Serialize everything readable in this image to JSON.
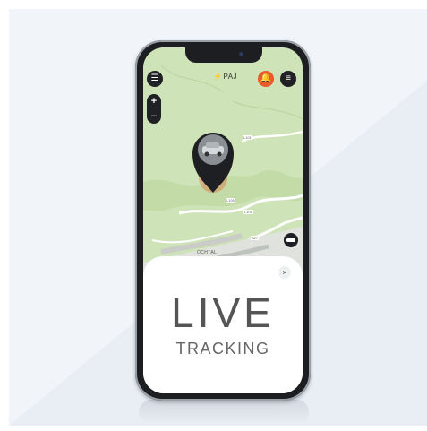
{
  "app": {
    "logo_text": "PAJ"
  },
  "map": {
    "road_labels": [
      "L101",
      "L105",
      "L105",
      "B27"
    ],
    "place_name": "OCHTAL"
  },
  "toolbar": {
    "menu_icon": "hamburger-menu-icon",
    "alarm_icon": "bell-alarm-icon",
    "list_icon": "list-icon",
    "zoom_in_label": "+",
    "zoom_out_label": "−"
  },
  "card": {
    "close_label": "×",
    "title": "LIVE",
    "subtitle": "TRACKING"
  },
  "colors": {
    "map_green": "#cfe3b8",
    "marker_orange": "#e85a2c",
    "pin_black": "#1e1f22",
    "phone_frame": "#1d1e22"
  }
}
